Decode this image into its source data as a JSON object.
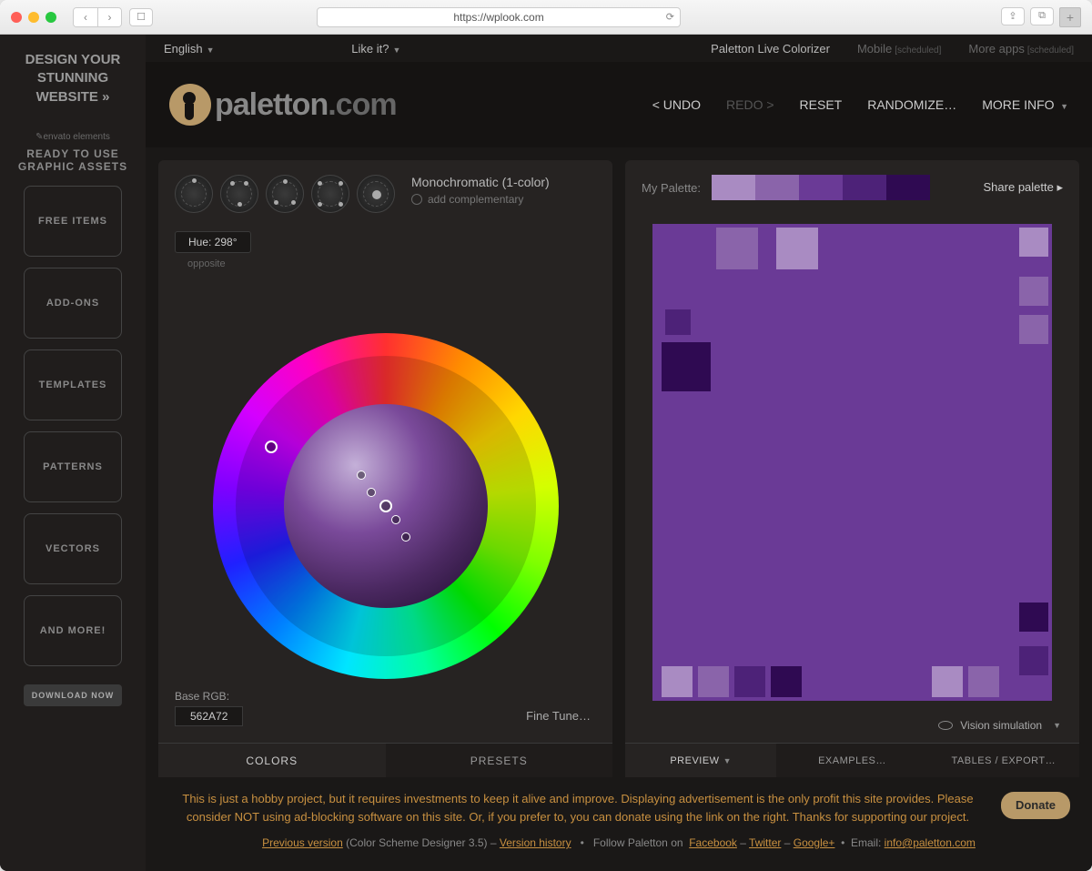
{
  "browser": {
    "url": "https://wplook.com"
  },
  "sidebar": {
    "hero": "DESIGN YOUR STUNNING WEBSITE »",
    "brand": "envato elements",
    "title": "READY TO USE GRAPHIC ASSETS",
    "items": [
      "FREE ITEMS",
      "ADD-ONS",
      "TEMPLATES",
      "PATTERNS",
      "VECTORS",
      "AND MORE!"
    ],
    "download": "DOWNLOAD NOW"
  },
  "topbar": {
    "language": "English",
    "like": "Like it?",
    "colorizer": "Paletton Live Colorizer",
    "mobile": "Mobile",
    "mobile_note": "[scheduled]",
    "more": "More apps",
    "more_note": "[scheduled]"
  },
  "logo": {
    "main": "paletton",
    "suffix": ".com"
  },
  "header": {
    "undo": "< UNDO",
    "redo": "REDO >",
    "reset": "RESET",
    "randomize": "RANDOMIZE…",
    "moreinfo": "MORE INFO"
  },
  "scheme": {
    "title": "Monochromatic (1-color)",
    "add_comp": "add complementary",
    "hue": "Hue: 298°",
    "opposite": "opposite",
    "base_label": "Base RGB:",
    "base_value": "562A72",
    "fine_tune": "Fine Tune…"
  },
  "left_tabs": {
    "colors": "COLORS",
    "presets": "PRESETS"
  },
  "palette": {
    "label": "My Palette:",
    "share": "Share palette",
    "colors": [
      "#a98bc2",
      "#8a64aa",
      "#6a3a96",
      "#4d2278",
      "#2f0a52"
    ],
    "vision": "Vision simulation"
  },
  "right_tabs": {
    "preview": "PREVIEW",
    "examples": "EXAMPLES…",
    "tables": "TABLES / EXPORT…"
  },
  "footer": {
    "msg": "This is just a hobby project, but it requires investments to keep it alive and improve. Displaying advertisement is the only profit this site provides. Please consider NOT using ad-blocking software on this site. Or, if you prefer to, you can donate using the link on the right. Thanks for supporting our project.",
    "donate": "Donate",
    "prev": "Previous version",
    "prev_note": "(Color Scheme Designer 3.5) –",
    "history": "Version history",
    "follow": "Follow Paletton on",
    "fb": "Facebook",
    "tw": "Twitter",
    "gp": "Google+",
    "email_label": "Email:",
    "email": "info@paletton.com"
  }
}
